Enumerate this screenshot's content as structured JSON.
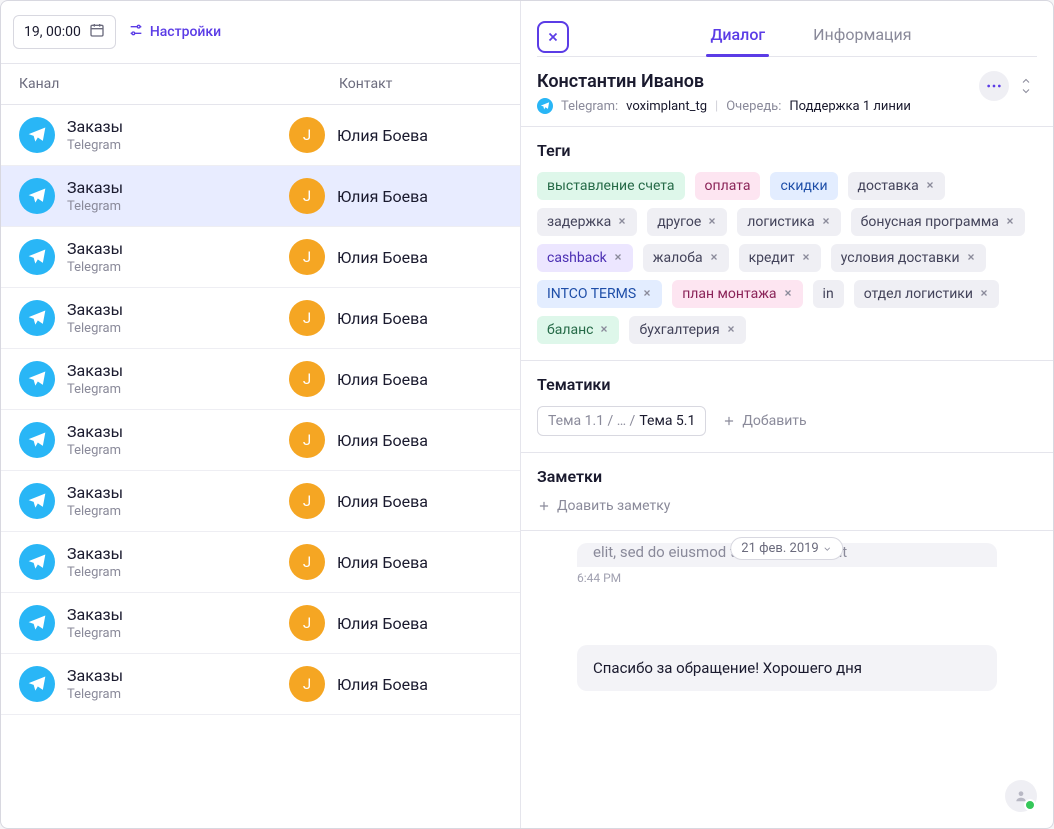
{
  "toolbar": {
    "date": "19, 00:00",
    "settings_label": "Настройки"
  },
  "table": {
    "header_channel": "Канал",
    "header_contact": "Контакт",
    "rows": [
      {
        "channel": "Заказы",
        "sub": "Telegram",
        "contact": "Юлия Боева",
        "initial": "J",
        "selected": false
      },
      {
        "channel": "Заказы",
        "sub": "Telegram",
        "contact": "Юлия Боева",
        "initial": "J",
        "selected": true
      },
      {
        "channel": "Заказы",
        "sub": "Telegram",
        "contact": "Юлия Боева",
        "initial": "J",
        "selected": false
      },
      {
        "channel": "Заказы",
        "sub": "Telegram",
        "contact": "Юлия Боева",
        "initial": "J",
        "selected": false
      },
      {
        "channel": "Заказы",
        "sub": "Telegram",
        "contact": "Юлия Боева",
        "initial": "J",
        "selected": false
      },
      {
        "channel": "Заказы",
        "sub": "Telegram",
        "contact": "Юлия Боева",
        "initial": "J",
        "selected": false
      },
      {
        "channel": "Заказы",
        "sub": "Telegram",
        "contact": "Юлия Боева",
        "initial": "J",
        "selected": false
      },
      {
        "channel": "Заказы",
        "sub": "Telegram",
        "contact": "Юлия Боева",
        "initial": "J",
        "selected": false
      },
      {
        "channel": "Заказы",
        "sub": "Telegram",
        "contact": "Юлия Боева",
        "initial": "J",
        "selected": false
      },
      {
        "channel": "Заказы",
        "sub": "Telegram",
        "contact": "Юлия Боева",
        "initial": "J",
        "selected": false
      }
    ]
  },
  "panel": {
    "tabs": {
      "dialog": "Диалог",
      "info": "Информация"
    },
    "contact_name": "Константин Иванов",
    "meta": {
      "tg_label": "Telegram:",
      "tg_value": "voximplant_tg",
      "queue_label": "Очередь:",
      "queue_value": "Поддержка 1 линии"
    },
    "tags_title": "Теги",
    "tags": [
      {
        "label": "выставление счета",
        "color": "green",
        "removable": false
      },
      {
        "label": "оплата",
        "color": "pink",
        "removable": false
      },
      {
        "label": "скидки",
        "color": "blue",
        "removable": false
      },
      {
        "label": "доставка",
        "color": "gray",
        "removable": true
      },
      {
        "label": "задержка",
        "color": "gray",
        "removable": true
      },
      {
        "label": "другое",
        "color": "gray",
        "removable": true
      },
      {
        "label": "логистика",
        "color": "gray",
        "removable": true
      },
      {
        "label": "бонусная программа",
        "color": "gray",
        "removable": true
      },
      {
        "label": "cashback",
        "color": "purple",
        "removable": true
      },
      {
        "label": "жалоба",
        "color": "gray",
        "removable": true
      },
      {
        "label": "кредит",
        "color": "gray",
        "removable": true
      },
      {
        "label": "условия доставки",
        "color": "gray",
        "removable": true
      },
      {
        "label": "INTCO TERMS",
        "color": "blue",
        "removable": true
      },
      {
        "label": "план монтажа",
        "color": "pink",
        "removable": true
      },
      {
        "label": "in",
        "color": "gray",
        "removable": false
      },
      {
        "label": "отдел логистики",
        "color": "gray",
        "removable": true
      },
      {
        "label": "баланс",
        "color": "green",
        "removable": true
      },
      {
        "label": "бухгалтерия",
        "color": "gray",
        "removable": true
      }
    ],
    "topics_title": "Тематики",
    "topic_chip": {
      "p1": "Тема 1.1 / … /",
      "p2": "Тема 5.1"
    },
    "add_label": "Добавить",
    "notes_title": "Заметки",
    "add_note_label": "Доавить заметку",
    "chat": {
      "fragment": "elit, sed do eiusmod tempor incididunt",
      "date_chip": "21 фев. 2019",
      "time": "6:44 PM",
      "message": "Спасибо за обращение! Хорошего дня"
    }
  }
}
